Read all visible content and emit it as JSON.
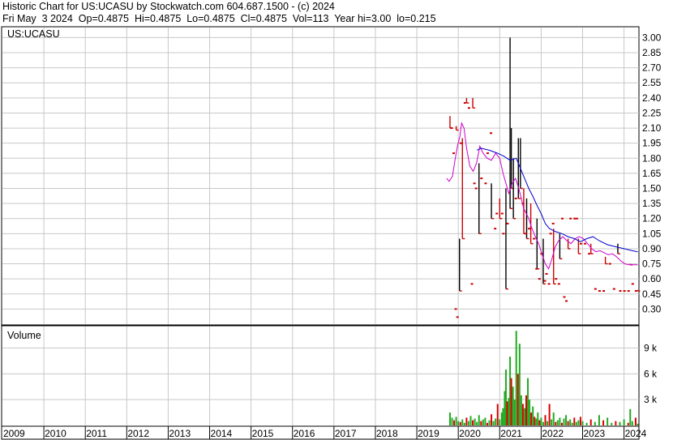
{
  "header": {
    "line1": "Historic Chart for US:UCASU by Stockwatch.com 604.687.1500 - (c) 2024",
    "line2": "Fri May  3 2024  Op=0.4875  Hi=0.4875  Lo=0.4875  Cl=0.4875  Vol=113  Year hi=3.00  lo=0.215"
  },
  "colors": {
    "price_bar": "#000000",
    "price_drop": "#cc0000",
    "ma_long": "#0000cc",
    "ma_short": "#cc00cc",
    "vol_up": "#22aa22",
    "vol_down": "#dd0000",
    "grid": "#c8c8c8"
  },
  "chart_data": [
    {
      "type": "line",
      "title": "US:UCASU",
      "ylim": [
        0.15,
        3.1
      ],
      "y_ticks": [
        "3.00",
        "2.85",
        "2.70",
        "2.55",
        "2.40",
        "2.25",
        "2.10",
        "1.95",
        "1.80",
        "1.65",
        "1.50",
        "1.35",
        "1.20",
        "1.05",
        "0.90",
        "0.75",
        "0.60",
        "0.45",
        "0.30"
      ],
      "x_ticks": [
        "2009",
        "2010",
        "2011",
        "2012",
        "2013",
        "2014",
        "2015",
        "2016",
        "2017",
        "2018",
        "2019",
        "2020",
        "2021",
        "2022",
        "2023",
        "2024"
      ],
      "price_bars": [
        {
          "t": 2019.8,
          "hi": 2.22,
          "lo": 2.1,
          "up": false
        },
        {
          "t": 2019.95,
          "hi": 2.12,
          "lo": 2.08,
          "up": false
        },
        {
          "t": 2020.03,
          "hi": 1.0,
          "lo": 0.48,
          "up": true
        },
        {
          "t": 2020.1,
          "hi": 2.0,
          "lo": 1.0,
          "up": false
        },
        {
          "t": 2020.2,
          "hi": 2.4,
          "lo": 2.35,
          "up": false
        },
        {
          "t": 2020.35,
          "hi": 2.4,
          "lo": 2.3,
          "up": false
        },
        {
          "t": 2020.5,
          "hi": 1.75,
          "lo": 1.05,
          "up": true
        },
        {
          "t": 2020.8,
          "hi": 1.55,
          "lo": 1.2,
          "up": true
        },
        {
          "t": 2021.0,
          "hi": 1.4,
          "lo": 1.2,
          "up": false
        },
        {
          "t": 2021.15,
          "hi": 1.5,
          "lo": 0.5,
          "up": true
        },
        {
          "t": 2021.25,
          "hi": 3.0,
          "lo": 1.3,
          "up": true
        },
        {
          "t": 2021.28,
          "hi": 2.1,
          "lo": 1.5,
          "up": true
        },
        {
          "t": 2021.33,
          "hi": 1.8,
          "lo": 1.2,
          "up": true
        },
        {
          "t": 2021.45,
          "hi": 2.0,
          "lo": 1.4,
          "up": true
        },
        {
          "t": 2021.5,
          "hi": 2.0,
          "lo": 1.5,
          "up": true
        },
        {
          "t": 2021.58,
          "hi": 1.5,
          "lo": 1.05,
          "up": false
        },
        {
          "t": 2021.65,
          "hi": 1.4,
          "lo": 1.0,
          "up": true
        },
        {
          "t": 2021.75,
          "hi": 1.35,
          "lo": 0.95,
          "up": false
        },
        {
          "t": 2021.9,
          "hi": 1.2,
          "lo": 0.7,
          "up": true
        },
        {
          "t": 2022.05,
          "hi": 1.0,
          "lo": 0.55,
          "up": true
        },
        {
          "t": 2022.3,
          "hi": 1.1,
          "lo": 0.55,
          "up": false
        },
        {
          "t": 2022.45,
          "hi": 1.05,
          "lo": 0.8,
          "up": true
        },
        {
          "t": 2022.65,
          "hi": 1.0,
          "lo": 0.9,
          "up": false
        },
        {
          "t": 2022.9,
          "hi": 1.0,
          "lo": 0.85,
          "up": false
        },
        {
          "t": 2023.2,
          "hi": 0.95,
          "lo": 0.85,
          "up": false
        },
        {
          "t": 2023.55,
          "hi": 0.82,
          "lo": 0.75,
          "up": false
        },
        {
          "t": 2023.85,
          "hi": 0.95,
          "lo": 0.85,
          "up": true
        },
        {
          "t": 2024.15,
          "hi": 0.75,
          "lo": 0.74,
          "up": false
        },
        {
          "t": 2024.33,
          "hi": 0.49,
          "lo": 0.48,
          "up": false
        }
      ],
      "price_dots": [
        [
          2019.83,
          2.1
        ],
        [
          2019.88,
          1.85
        ],
        [
          2019.93,
          0.3
        ],
        [
          2019.97,
          0.22
        ],
        [
          2020.05,
          1.95
        ],
        [
          2020.15,
          2.35
        ],
        [
          2020.25,
          2.3
        ],
        [
          2020.32,
          0.55
        ],
        [
          2020.38,
          1.55
        ],
        [
          2020.42,
          1.5
        ],
        [
          2020.55,
          1.6
        ],
        [
          2020.65,
          1.55
        ],
        [
          2020.7,
          1.85
        ],
        [
          2020.78,
          2.05
        ],
        [
          2020.88,
          1.1
        ],
        [
          2020.92,
          1.25
        ],
        [
          2021.05,
          1.25
        ],
        [
          2021.08,
          1.05
        ],
        [
          2021.18,
          1.15
        ],
        [
          2021.38,
          1.4
        ],
        [
          2021.55,
          1.35
        ],
        [
          2021.62,
          1.05
        ],
        [
          2021.7,
          1.1
        ],
        [
          2021.82,
          1.0
        ],
        [
          2021.88,
          0.7
        ],
        [
          2021.95,
          0.6
        ],
        [
          2022.0,
          0.85
        ],
        [
          2022.08,
          0.58
        ],
        [
          2022.12,
          0.65
        ],
        [
          2022.18,
          0.55
        ],
        [
          2022.22,
          1.05
        ],
        [
          2022.28,
          1.15
        ],
        [
          2022.35,
          0.6
        ],
        [
          2022.42,
          0.55
        ],
        [
          2022.5,
          1.2
        ],
        [
          2022.55,
          0.42
        ],
        [
          2022.6,
          0.38
        ],
        [
          2022.7,
          1.2
        ],
        [
          2022.8,
          1.2
        ],
        [
          2022.85,
          1.2
        ],
        [
          2022.95,
          0.95
        ],
        [
          2023.05,
          0.95
        ],
        [
          2023.15,
          0.85
        ],
        [
          2023.3,
          0.5
        ],
        [
          2023.4,
          0.48
        ],
        [
          2023.5,
          0.48
        ],
        [
          2023.65,
          0.75
        ],
        [
          2023.75,
          0.5
        ],
        [
          2023.9,
          0.48
        ],
        [
          2024.0,
          0.48
        ],
        [
          2024.1,
          0.48
        ],
        [
          2024.2,
          0.55
        ],
        [
          2024.28,
          0.48
        ]
      ],
      "ma_long": [
        [
          2020.45,
          1.88
        ],
        [
          2020.55,
          1.9
        ],
        [
          2020.75,
          1.88
        ],
        [
          2020.95,
          1.85
        ],
        [
          2021.1,
          1.82
        ],
        [
          2021.25,
          1.78
        ],
        [
          2021.4,
          1.8
        ],
        [
          2021.5,
          1.7
        ],
        [
          2021.6,
          1.6
        ],
        [
          2021.7,
          1.5
        ],
        [
          2021.8,
          1.42
        ],
        [
          2021.9,
          1.33
        ],
        [
          2022.0,
          1.25
        ],
        [
          2022.1,
          1.15
        ],
        [
          2022.2,
          1.1
        ],
        [
          2022.35,
          1.07
        ],
        [
          2022.5,
          1.05
        ],
        [
          2022.65,
          1.02
        ],
        [
          2022.8,
          1.0
        ],
        [
          2022.95,
          0.97
        ],
        [
          2023.1,
          1.0
        ],
        [
          2023.25,
          1.02
        ],
        [
          2023.4,
          0.98
        ],
        [
          2023.6,
          0.94
        ],
        [
          2023.8,
          0.92
        ],
        [
          2024.0,
          0.9
        ],
        [
          2024.2,
          0.88
        ],
        [
          2024.33,
          0.87
        ]
      ],
      "ma_short": [
        [
          2019.72,
          1.6
        ],
        [
          2019.78,
          1.57
        ],
        [
          2019.86,
          1.62
        ],
        [
          2019.92,
          1.78
        ],
        [
          2019.98,
          1.92
        ],
        [
          2020.04,
          2.02
        ],
        [
          2020.08,
          2.15
        ],
        [
          2020.14,
          2.1
        ],
        [
          2020.2,
          1.9
        ],
        [
          2020.28,
          1.72
        ],
        [
          2020.36,
          1.67
        ],
        [
          2020.44,
          1.75
        ],
        [
          2020.52,
          1.92
        ],
        [
          2020.6,
          1.85
        ],
        [
          2020.7,
          1.8
        ],
        [
          2020.8,
          1.78
        ],
        [
          2020.9,
          1.85
        ],
        [
          2021.0,
          1.8
        ],
        [
          2021.08,
          1.65
        ],
        [
          2021.15,
          1.55
        ],
        [
          2021.22,
          1.45
        ],
        [
          2021.3,
          1.55
        ],
        [
          2021.38,
          1.6
        ],
        [
          2021.46,
          1.5
        ],
        [
          2021.52,
          1.4
        ],
        [
          2021.58,
          1.3
        ],
        [
          2021.64,
          1.25
        ],
        [
          2021.7,
          1.2
        ],
        [
          2021.78,
          1.1
        ],
        [
          2021.86,
          1.02
        ],
        [
          2021.94,
          0.95
        ],
        [
          2022.02,
          0.85
        ],
        [
          2022.1,
          0.75
        ],
        [
          2022.18,
          0.7
        ],
        [
          2022.26,
          0.8
        ],
        [
          2022.34,
          0.92
        ],
        [
          2022.42,
          0.98
        ],
        [
          2022.52,
          1.02
        ],
        [
          2022.62,
          0.98
        ],
        [
          2022.72,
          0.95
        ],
        [
          2022.82,
          1.0
        ],
        [
          2022.92,
          1.02
        ],
        [
          2023.02,
          1.0
        ],
        [
          2023.12,
          0.95
        ],
        [
          2023.22,
          0.9
        ],
        [
          2023.32,
          0.87
        ],
        [
          2023.42,
          0.88
        ],
        [
          2023.52,
          0.86
        ],
        [
          2023.62,
          0.84
        ],
        [
          2023.72,
          0.85
        ],
        [
          2023.82,
          0.82
        ],
        [
          2023.92,
          0.78
        ],
        [
          2024.02,
          0.75
        ],
        [
          2024.12,
          0.74
        ],
        [
          2024.22,
          0.74
        ],
        [
          2024.33,
          0.74
        ]
      ]
    },
    {
      "type": "bar",
      "title": "Volume",
      "ylim": [
        0,
        11500
      ],
      "y_ticks": [
        "9 k",
        "6 k",
        "3 k"
      ],
      "y_tick_values": [
        9000,
        6000,
        3000
      ],
      "bars": [
        [
          2019.8,
          1500,
          "up"
        ],
        [
          2019.85,
          900,
          "up"
        ],
        [
          2019.9,
          600,
          "down"
        ],
        [
          2019.95,
          1000,
          "up"
        ],
        [
          2020.0,
          500,
          "up"
        ],
        [
          2020.05,
          400,
          "down"
        ],
        [
          2020.1,
          700,
          "up"
        ],
        [
          2020.15,
          300,
          "up"
        ],
        [
          2020.2,
          900,
          "down"
        ],
        [
          2020.25,
          500,
          "up"
        ],
        [
          2020.3,
          1100,
          "up"
        ],
        [
          2020.35,
          600,
          "down"
        ],
        [
          2020.4,
          800,
          "up"
        ],
        [
          2020.45,
          400,
          "up"
        ],
        [
          2020.5,
          1200,
          "up"
        ],
        [
          2020.55,
          500,
          "down"
        ],
        [
          2020.6,
          700,
          "up"
        ],
        [
          2020.65,
          900,
          "up"
        ],
        [
          2020.7,
          300,
          "down"
        ],
        [
          2020.75,
          600,
          "up"
        ],
        [
          2020.8,
          1300,
          "down"
        ],
        [
          2020.85,
          500,
          "up"
        ],
        [
          2020.9,
          800,
          "up"
        ],
        [
          2020.95,
          2500,
          "down"
        ],
        [
          2021.0,
          700,
          "up"
        ],
        [
          2021.05,
          1500,
          "up"
        ],
        [
          2021.08,
          2000,
          "up"
        ],
        [
          2021.12,
          4000,
          "up"
        ],
        [
          2021.15,
          6500,
          "up"
        ],
        [
          2021.18,
          2800,
          "down"
        ],
        [
          2021.22,
          3200,
          "up"
        ],
        [
          2021.25,
          8000,
          "up"
        ],
        [
          2021.28,
          5500,
          "down"
        ],
        [
          2021.32,
          4500,
          "up"
        ],
        [
          2021.36,
          3000,
          "up"
        ],
        [
          2021.4,
          11000,
          "up"
        ],
        [
          2021.44,
          6000,
          "down"
        ],
        [
          2021.48,
          9500,
          "up"
        ],
        [
          2021.52,
          3500,
          "up"
        ],
        [
          2021.56,
          2500,
          "down"
        ],
        [
          2021.6,
          2000,
          "up"
        ],
        [
          2021.64,
          3500,
          "down"
        ],
        [
          2021.68,
          5500,
          "up"
        ],
        [
          2021.72,
          3000,
          "up"
        ],
        [
          2021.76,
          1500,
          "down"
        ],
        [
          2021.8,
          2200,
          "up"
        ],
        [
          2021.84,
          1000,
          "down"
        ],
        [
          2021.88,
          800,
          "up"
        ],
        [
          2021.92,
          1500,
          "up"
        ],
        [
          2021.96,
          600,
          "down"
        ],
        [
          2022.0,
          900,
          "up"
        ],
        [
          2022.05,
          400,
          "up"
        ],
        [
          2022.1,
          1200,
          "down"
        ],
        [
          2022.15,
          500,
          "up"
        ],
        [
          2022.2,
          2500,
          "down"
        ],
        [
          2022.25,
          700,
          "up"
        ],
        [
          2022.3,
          1500,
          "up"
        ],
        [
          2022.35,
          400,
          "down"
        ],
        [
          2022.4,
          600,
          "up"
        ],
        [
          2022.45,
          900,
          "up"
        ],
        [
          2022.5,
          300,
          "down"
        ],
        [
          2022.55,
          800,
          "up"
        ],
        [
          2022.6,
          1200,
          "up"
        ],
        [
          2022.65,
          500,
          "down"
        ],
        [
          2022.7,
          700,
          "up"
        ],
        [
          2022.75,
          300,
          "up"
        ],
        [
          2022.8,
          900,
          "down"
        ],
        [
          2022.85,
          400,
          "up"
        ],
        [
          2022.9,
          600,
          "up"
        ],
        [
          2022.95,
          1000,
          "down"
        ],
        [
          2023.0,
          500,
          "up"
        ],
        [
          2023.1,
          300,
          "up"
        ],
        [
          2023.2,
          700,
          "down"
        ],
        [
          2023.3,
          400,
          "up"
        ],
        [
          2023.4,
          1200,
          "up"
        ],
        [
          2023.5,
          600,
          "down"
        ],
        [
          2023.6,
          900,
          "up"
        ],
        [
          2023.7,
          300,
          "up"
        ],
        [
          2023.8,
          500,
          "down"
        ],
        [
          2023.9,
          400,
          "up"
        ],
        [
          2024.0,
          700,
          "up"
        ],
        [
          2024.1,
          300,
          "down"
        ],
        [
          2024.15,
          1900,
          "up"
        ],
        [
          2024.2,
          500,
          "up"
        ],
        [
          2024.28,
          900,
          "down"
        ],
        [
          2024.33,
          200,
          "up"
        ]
      ]
    }
  ]
}
